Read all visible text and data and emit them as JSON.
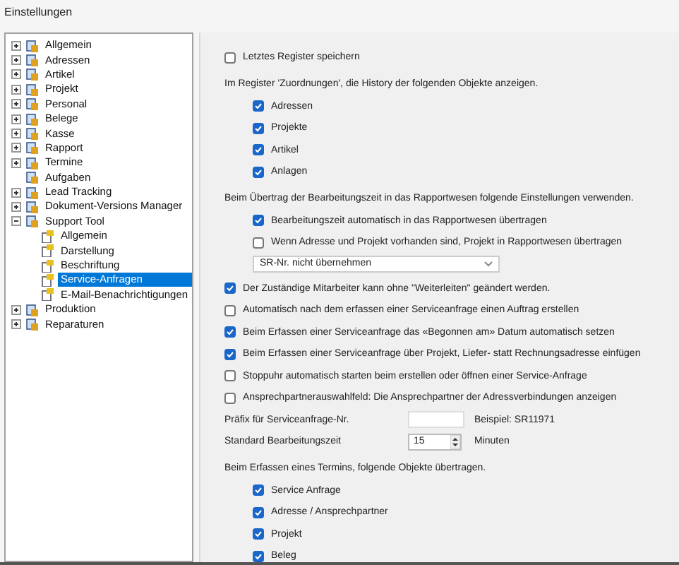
{
  "window": {
    "title": "Einstellungen"
  },
  "tree": [
    {
      "label": "Allgemein",
      "kind": "group",
      "expanded": false,
      "selected": false
    },
    {
      "label": "Adressen",
      "kind": "group",
      "expanded": false,
      "selected": false
    },
    {
      "label": "Artikel",
      "kind": "group",
      "expanded": false,
      "selected": false
    },
    {
      "label": "Projekt",
      "kind": "group",
      "expanded": false,
      "selected": false
    },
    {
      "label": "Personal",
      "kind": "group",
      "expanded": false,
      "selected": false
    },
    {
      "label": "Belege",
      "kind": "group",
      "expanded": false,
      "selected": false
    },
    {
      "label": "Kasse",
      "kind": "group",
      "expanded": false,
      "selected": false
    },
    {
      "label": "Rapport",
      "kind": "group",
      "expanded": false,
      "selected": false
    },
    {
      "label": "Termine",
      "kind": "group",
      "expanded": false,
      "selected": false
    },
    {
      "label": "Aufgaben",
      "kind": "leaf",
      "selected": false
    },
    {
      "label": "Lead Tracking",
      "kind": "group",
      "expanded": false,
      "selected": false
    },
    {
      "label": "Dokument-Versions Manager",
      "kind": "group",
      "expanded": false,
      "selected": false
    },
    {
      "label": "Support Tool",
      "kind": "group",
      "expanded": true,
      "selected": false,
      "children": [
        {
          "label": "Allgemein",
          "selected": false
        },
        {
          "label": "Darstellung",
          "selected": false
        },
        {
          "label": "Beschriftung",
          "selected": false
        },
        {
          "label": "Service-Anfragen",
          "selected": true
        },
        {
          "label": "E-Mail-Benachrichtigungen",
          "selected": false
        }
      ]
    },
    {
      "label": "Produktion",
      "kind": "group",
      "expanded": false,
      "selected": false
    },
    {
      "label": "Reparaturen",
      "kind": "group",
      "expanded": false,
      "selected": false
    }
  ],
  "settings": [
    {
      "kind": "checkbox",
      "label": "Letztes Register speichern",
      "checked": false
    },
    {
      "kind": "group",
      "label": "Im Register 'Zuordnungen', die History der folgenden Objekte anzeigen.",
      "options": [
        {
          "kind": "checkbox",
          "label": "Adressen",
          "checked": true
        },
        {
          "kind": "checkbox",
          "label": "Projekte",
          "checked": true
        },
        {
          "kind": "checkbox",
          "label": "Artikel",
          "checked": true
        },
        {
          "kind": "checkbox",
          "label": "Anlagen",
          "checked": true
        }
      ]
    },
    {
      "kind": "group",
      "label": "Beim Übertrag der Bearbeitungszeit in das Rapportwesen folgende Einstellungen verwenden.",
      "options": [
        {
          "kind": "checkbox",
          "label": "Bearbeitungszeit automatisch in das Rapportwesen übertragen",
          "checked": true
        },
        {
          "kind": "checkbox",
          "label": "Wenn Adresse und Projekt vorhanden sind, Projekt in Rapportwesen übertragen",
          "checked": false
        },
        {
          "kind": "select",
          "value": "SR-Nr. nicht übernehmen"
        }
      ]
    },
    {
      "kind": "checkbox",
      "label": "Der Zuständige Mitarbeiter kann ohne \"Weiterleiten\" geändert werden.",
      "checked": true
    },
    {
      "kind": "checkbox",
      "label": "Automatisch nach dem erfassen einer Serviceanfrage einen Auftrag erstellen",
      "checked": false
    },
    {
      "kind": "checkbox",
      "label": "Beim Erfassen einer Serviceanfrage das «Begonnen am» Datum automatisch setzen",
      "checked": true
    },
    {
      "kind": "checkbox",
      "label": "Beim Erfassen einer Serviceanfrage über Projekt, Liefer- statt Rechnungsadresse einfügen",
      "checked": true
    },
    {
      "kind": "checkbox",
      "label": "Stoppuhr automatisch starten beim erstellen oder öffnen einer Service-Anfrage",
      "checked": false
    },
    {
      "kind": "checkbox",
      "label": "Ansprechpartnerauswahlfeld: Die Ansprechpartner der Adressverbindungen anzeigen",
      "checked": false
    },
    {
      "kind": "field",
      "label": "Präfix für Serviceanfrage-Nr.",
      "note": "Beispiel: SR11971"
    },
    {
      "kind": "spin",
      "label": "Standard Bearbeitungszeit",
      "value": "15",
      "note": "Minuten"
    },
    {
      "kind": "group",
      "label": "Beim Erfassen eines Termins, folgende Objekte übertragen.",
      "options": [
        {
          "kind": "checkbox",
          "label": "Service Anfrage",
          "checked": true
        },
        {
          "kind": "checkbox",
          "label": "Adresse / Ansprechpartner",
          "checked": true
        },
        {
          "kind": "checkbox",
          "label": "Projekt",
          "checked": true
        },
        {
          "kind": "checkbox",
          "label": "Beleg",
          "checked": true
        }
      ]
    }
  ]
}
